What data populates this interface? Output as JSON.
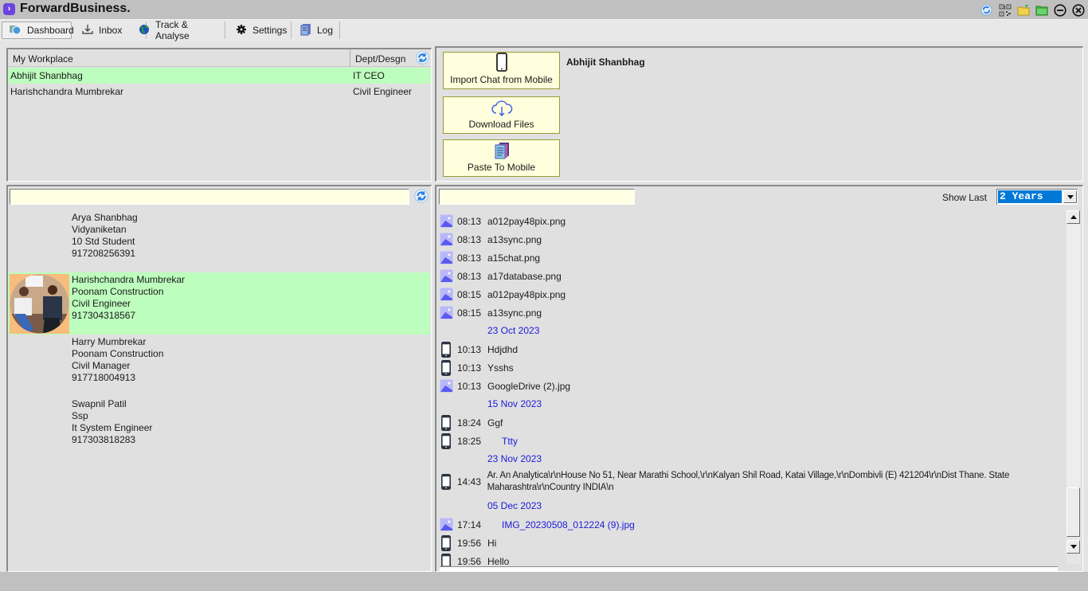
{
  "app": {
    "title": "ForwardBusiness.",
    "logo_glyph": "›"
  },
  "window_icons": [
    {
      "name": "refresh-icon"
    },
    {
      "name": "qr-code-icon"
    },
    {
      "name": "folder-sync-icon"
    },
    {
      "name": "green-folder-icon"
    },
    {
      "name": "minimize-icon"
    },
    {
      "name": "close-icon"
    }
  ],
  "tabs": [
    {
      "label": "Dashboard",
      "icon": "dashboard-icon",
      "active": true
    },
    {
      "label": "Inbox",
      "icon": "inbox-download-icon",
      "active": false
    },
    {
      "label": "Track & Analyse",
      "icon": "globe-icon",
      "active": false
    },
    {
      "label": "Settings",
      "icon": "gear-icon",
      "active": false
    },
    {
      "label": "Log",
      "icon": "log-book-icon",
      "active": false
    }
  ],
  "workplace": {
    "col_name": "My Workplace",
    "col_dept": "Dept/Desgn",
    "rows": [
      {
        "name": "Abhijit Shanbhag",
        "dept": "IT CEO",
        "selected": true
      },
      {
        "name": "Harishchandra Mumbrekar",
        "dept": "Civil Engineer",
        "selected": false
      }
    ]
  },
  "actions": {
    "selected_name": "Abhijit Shanbhag",
    "buttons": [
      {
        "label": "Import Chat from Mobile",
        "icon": "mobile-phone-icon"
      },
      {
        "label": "Download Files",
        "icon": "cloud-download-icon"
      },
      {
        "label": "Paste To Mobile",
        "icon": "documents-icon"
      }
    ]
  },
  "contacts": {
    "search_value": "",
    "items": [
      {
        "name": "Arya Shanbhag",
        "org": "Vidyaniketan",
        "role": "10 Std Student",
        "phone": "917208256391",
        "has_avatar": false,
        "selected": false
      },
      {
        "name": "Harishchandra Mumbrekar",
        "org": "Poonam Construction",
        "role": "Civil Engineer",
        "phone": "917304318567",
        "has_avatar": true,
        "selected": true
      },
      {
        "name": "Harry Mumbrekar",
        "org": "Poonam Construction",
        "role": "Civil Manager",
        "phone": "917718004913",
        "has_avatar": false,
        "selected": false
      },
      {
        "name": "Swapnil Patil",
        "org": "Ssp",
        "role": "It System Engineer",
        "phone": "917303818283",
        "has_avatar": false,
        "selected": false
      }
    ]
  },
  "chat": {
    "search_value": "",
    "show_last_label": "Show Last",
    "show_last_value": "2 Years",
    "entries": [
      {
        "type": "msg",
        "icon": "image",
        "time": "08:13",
        "text": "a012pay48pix.png"
      },
      {
        "type": "msg",
        "icon": "image",
        "time": "08:13",
        "text": "a13sync.png"
      },
      {
        "type": "msg",
        "icon": "image",
        "time": "08:13",
        "text": "a15chat.png"
      },
      {
        "type": "msg",
        "icon": "image",
        "time": "08:13",
        "text": "a17database.png"
      },
      {
        "type": "msg",
        "icon": "image",
        "time": "08:15",
        "text": "a012pay48pix.png"
      },
      {
        "type": "msg",
        "icon": "image",
        "time": "08:15",
        "text": "a13sync.png"
      },
      {
        "type": "date",
        "text": "23 Oct 2023"
      },
      {
        "type": "msg",
        "icon": "phone",
        "time": "10:13",
        "text": "Hdjdhd"
      },
      {
        "type": "msg",
        "icon": "phone",
        "time": "10:13",
        "text": "Ysshs"
      },
      {
        "type": "msg",
        "icon": "image",
        "time": "10:13",
        "text": "GoogleDrive (2).jpg"
      },
      {
        "type": "date",
        "text": "15 Nov 2023"
      },
      {
        "type": "msg",
        "icon": "phone",
        "time": "18:24",
        "text": "Ggf"
      },
      {
        "type": "msg",
        "icon": "phone",
        "time": "18:25",
        "text": "Ttty",
        "outgoing": true
      },
      {
        "type": "date",
        "text": "23 Nov 2023"
      },
      {
        "type": "long",
        "icon": "phone",
        "time": "14:43",
        "text": "Ar. An Analytica\\r\\nHouse No 51, Near Marathi School,\\r\\nKalyan Shil Road, Katai Village,\\r\\nDombivli (E) 421204\\r\\nDist Thane. State Maharashtra\\r\\nCountry INDIA\\n"
      },
      {
        "type": "date",
        "text": "05 Dec 2023"
      },
      {
        "type": "msg",
        "icon": "image",
        "time": "17:14",
        "text": "IMG_20230508_012224 (9).jpg",
        "outgoing": true
      },
      {
        "type": "msg",
        "icon": "phone",
        "time": "19:56",
        "text": "Hi"
      },
      {
        "type": "msg",
        "icon": "phone",
        "time": "19:56",
        "text": "Hello"
      }
    ]
  },
  "colors": {
    "selected_row": "#bdfdbd",
    "input_bg": "#ffffe4",
    "date_link": "#1a1adc",
    "dropdown_selected": "#0078d7"
  }
}
